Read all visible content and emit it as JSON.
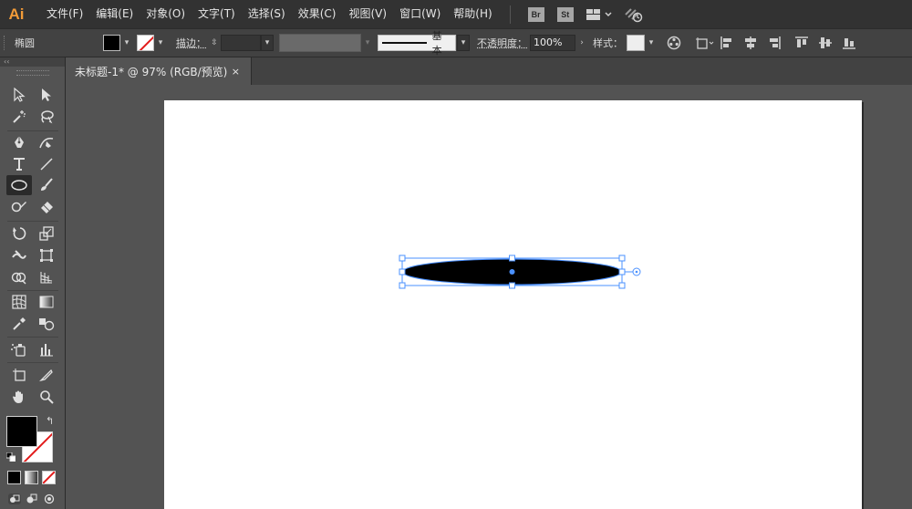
{
  "app": {
    "logo": "Ai",
    "menu": [
      "文件(F)",
      "编辑(E)",
      "对象(O)",
      "文字(T)",
      "选择(S)",
      "效果(C)",
      "视图(V)",
      "窗口(W)",
      "帮助(H)"
    ],
    "badges": [
      "Br",
      "St"
    ]
  },
  "controlbar": {
    "object_type": "椭圆",
    "stroke_label": "描边：",
    "brush_label": "基本",
    "opacity_label": "不透明度：",
    "opacity_value": "100%",
    "style_label": "样式："
  },
  "document": {
    "tab_title": "未标题-1* @ 97% (RGB/预览)",
    "close_glyph": "×"
  },
  "toolbar": {
    "collapse_glyph": "‹‹",
    "swap_glyph": "↰"
  },
  "colors": {
    "accent": "#4a90ff",
    "fill": "#000000",
    "stroke_none": "#e21b1b",
    "logo": "#f29b38"
  }
}
